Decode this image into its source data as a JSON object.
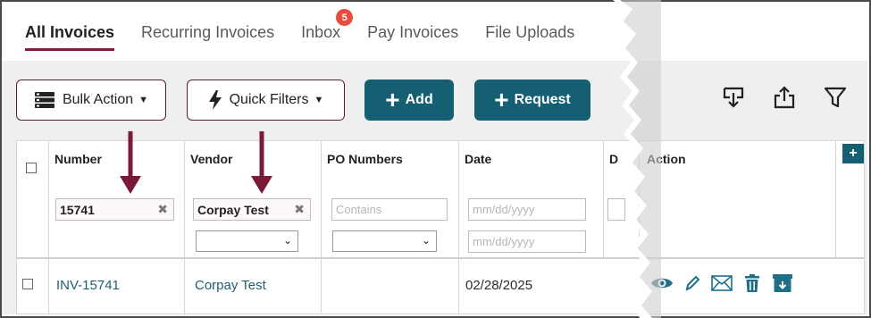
{
  "tabs": [
    {
      "label": "All Invoices",
      "active": true
    },
    {
      "label": "Recurring Invoices",
      "active": false
    },
    {
      "label": "Inbox",
      "active": false,
      "badge": "5"
    },
    {
      "label": "Pay Invoices",
      "active": false
    },
    {
      "label": "File Uploads",
      "active": false
    }
  ],
  "toolbar": {
    "bulk_action": "Bulk Action",
    "quick_filters": "Quick Filters",
    "add": "Add",
    "request": "Request"
  },
  "columns": {
    "number": "Number",
    "vendor": "Vendor",
    "po_numbers": "PO Numbers",
    "date": "Date",
    "due_partial": "D",
    "action": "Action"
  },
  "filters": {
    "number_value": "15741",
    "vendor_value": "Corpay Test",
    "po_placeholder": "Contains",
    "date_from_placeholder": "mm/dd/yyyy",
    "date_to_placeholder": "mm/dd/yyyy"
  },
  "rows": [
    {
      "number": "INV-15741",
      "vendor": "Corpay Test",
      "po": "",
      "date": "02/28/2025"
    }
  ],
  "colors": {
    "accent": "#155f72",
    "brand_maroon": "#5a1f33",
    "arrow": "#7a1a37",
    "badge": "#e74c3c"
  },
  "icons": {
    "bulk": "server-stack-icon",
    "quick_filters": "lightning-icon",
    "export": "download-tray-icon",
    "share": "upload-share-icon",
    "filter": "funnel-icon",
    "view": "eye-icon",
    "edit": "pencil-icon",
    "email": "envelope-icon",
    "delete": "trash-icon",
    "archive": "archive-box-icon"
  }
}
